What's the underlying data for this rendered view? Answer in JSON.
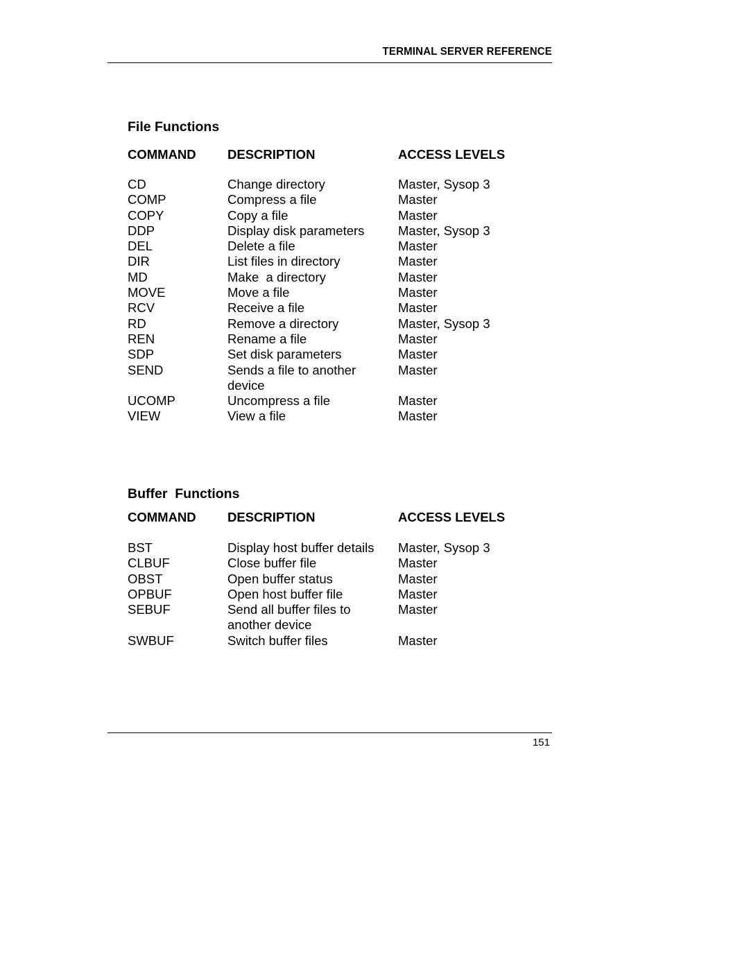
{
  "header": {
    "running_title": "TERMINAL SERVER REFERENCE"
  },
  "footer": {
    "page_number": "151"
  },
  "sections": [
    {
      "title": "File Functions",
      "columns": [
        "COMMAND",
        "DESCRIPTION",
        "ACCESS LEVELS"
      ],
      "rows": [
        {
          "command": "CD",
          "description": "Change directory",
          "access": "Master, Sysop 3"
        },
        {
          "command": "COMP",
          "description": "Compress a file",
          "access": "Master"
        },
        {
          "command": "COPY",
          "description": "Copy a file",
          "access": "Master"
        },
        {
          "command": "DDP",
          "description": "Display disk parameters",
          "access": "Master, Sysop 3"
        },
        {
          "command": "DEL",
          "description": "Delete a file",
          "access": "Master"
        },
        {
          "command": "DIR",
          "description": "List files in directory",
          "access": "Master"
        },
        {
          "command": "MD",
          "description": "Make  a directory",
          "access": "Master"
        },
        {
          "command": "MOVE",
          "description": "Move a file",
          "access": "Master"
        },
        {
          "command": "RCV",
          "description": "Receive a file",
          "access": "Master"
        },
        {
          "command": "RD",
          "description": "Remove a directory",
          "access": "Master, Sysop 3"
        },
        {
          "command": "REN",
          "description": "Rename a file",
          "access": "Master"
        },
        {
          "command": "SDP",
          "description": "Set disk parameters",
          "access": "Master"
        },
        {
          "command": "SEND",
          "description": "Sends a file to another device",
          "access": "Master"
        },
        {
          "command": "UCOMP",
          "description": "Uncompress a file",
          "access": "Master"
        },
        {
          "command": "VIEW",
          "description": "View a file",
          "access": "Master"
        }
      ]
    },
    {
      "title": "Buffer  Functions",
      "columns": [
        "COMMAND",
        "DESCRIPTION",
        "ACCESS LEVELS"
      ],
      "rows": [
        {
          "command": "BST",
          "description": "Display host buffer details",
          "access": "Master, Sysop 3"
        },
        {
          "command": "CLBUF",
          "description": "Close buffer file",
          "access": "Master"
        },
        {
          "command": "OBST",
          "description": "Open buffer status",
          "access": "Master"
        },
        {
          "command": "OPBUF",
          "description": "Open host buffer file",
          "access": "Master"
        },
        {
          "command": "SEBUF",
          "description": "Send all buffer files to another device",
          "access": "Master"
        },
        {
          "command": "SWBUF",
          "description": "Switch buffer files",
          "access": "Master"
        }
      ]
    }
  ]
}
